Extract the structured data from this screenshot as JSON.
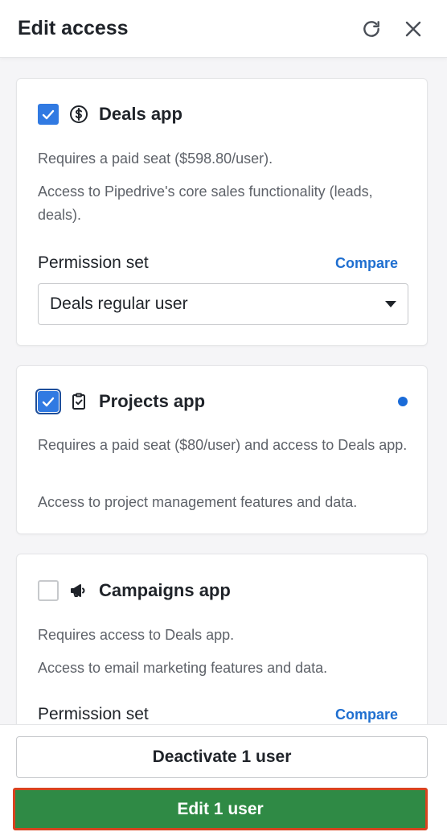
{
  "header": {
    "title": "Edit access",
    "refresh_icon": "refresh-icon",
    "close_icon": "close-icon"
  },
  "apps": [
    {
      "title": "Deals app",
      "icon": "dollar-circle-icon",
      "checked": true,
      "seat_note": "Requires a paid seat ($598.80/user).",
      "description": "Access to Pipedrive's core sales functionality (leads, deals).",
      "permission_label": "Permission set",
      "compare_label": "Compare",
      "permission_value": "Deals regular user"
    },
    {
      "title": "Projects app",
      "icon": "clipboard-check-icon",
      "checked": true,
      "changed_indicator": true,
      "seat_note": "Requires a paid seat ($80/user) and access to Deals app.",
      "description": "Access to project management features and data."
    },
    {
      "title": "Campaigns app",
      "icon": "megaphone-icon",
      "checked": false,
      "seat_note": "Requires access to Deals app.",
      "description": "Access to email marketing features and data.",
      "permission_label": "Permission set",
      "compare_label": "Compare"
    }
  ],
  "footer": {
    "deactivate_label": "Deactivate 1 user",
    "edit_label": "Edit 1 user"
  },
  "colors": {
    "accent": "#317ae2",
    "link": "#1f6fd0",
    "primary_button": "#2f8a45",
    "highlight_outline": "#d8431f"
  }
}
